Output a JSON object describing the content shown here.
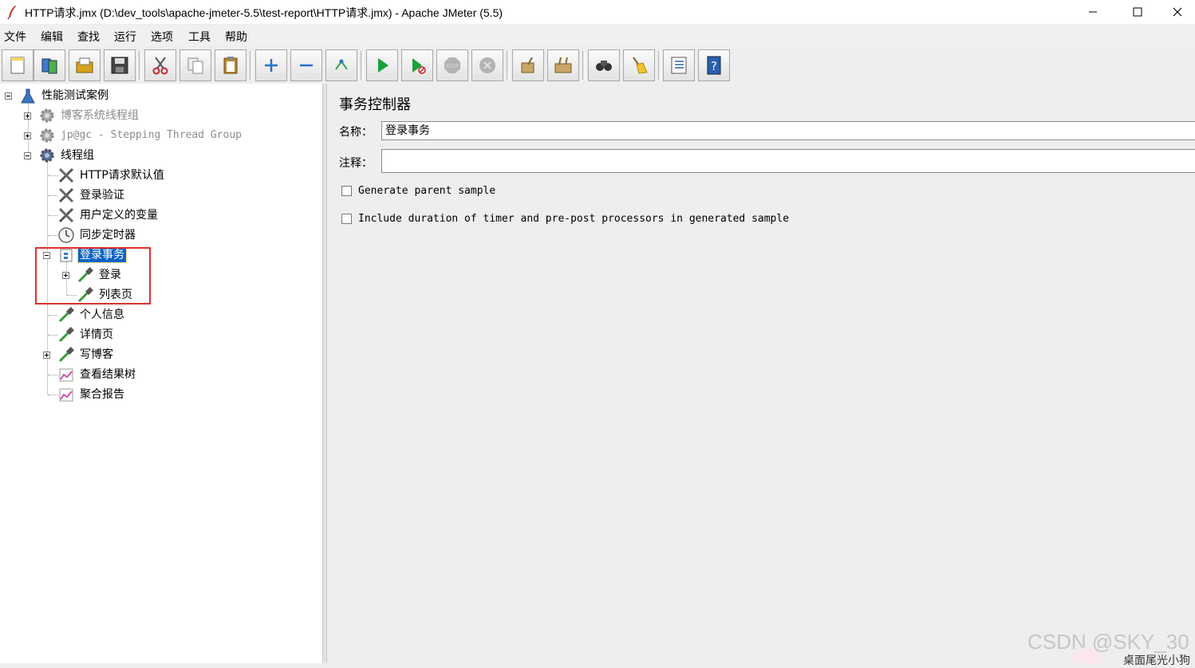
{
  "window": {
    "title": "HTTP请求.jmx (D:\\dev_tools\\apache-jmeter-5.5\\test-report\\HTTP请求.jmx) - Apache JMeter (5.5)"
  },
  "menu": [
    "文件",
    "编辑",
    "查找",
    "运行",
    "选项",
    "工具",
    "帮助"
  ],
  "toolbar": [
    "new-icon",
    "templates-icon",
    "open-icon",
    "save-icon",
    "cut-icon",
    "copy-icon",
    "paste-icon",
    "expand-icon",
    "collapse-icon",
    "toggle-icon",
    "start-icon",
    "start-no-pause-icon",
    "stop-icon",
    "shutdown-icon",
    "clear-icon",
    "clear-all-icon",
    "search-icon",
    "reset-search-icon",
    "function-helper-icon",
    "help-icon"
  ],
  "tree": {
    "root": "性能测试案例",
    "thread_group_1": "博客系统线程组",
    "thread_group_2": "jp@gc - Stepping Thread Group",
    "thread_group_3": "线程组",
    "http_defaults": "HTTP请求默认值",
    "login_verify": "登录验证",
    "user_vars": "用户定义的变量",
    "sync_timer": "同步定时器",
    "transaction": "登录事务",
    "login": "登录",
    "list_page": "列表页",
    "personal_info": "个人信息",
    "detail_page": "详情页",
    "write_blog": "写博客",
    "results_tree": "查看结果树",
    "aggregate_report": "聚合报告"
  },
  "panel": {
    "title": "事务控制器",
    "name_label": "名称：",
    "name_value": "登录事务",
    "comment_label": "注释：",
    "comment_value": "",
    "checkbox_parent_sample": "Generate parent sample",
    "checkbox_parent_sample_checked": false,
    "checkbox_include_timers": "Include duration of timer and pre-post processors in generated sample",
    "checkbox_include_timers_checked": false
  },
  "overlay": {
    "watermark": "CSDN @SKY_30",
    "corner_text": "桌面尾光小狗"
  },
  "colors": {
    "selection": "#0a64c8",
    "highlight_box": "#e03030"
  }
}
